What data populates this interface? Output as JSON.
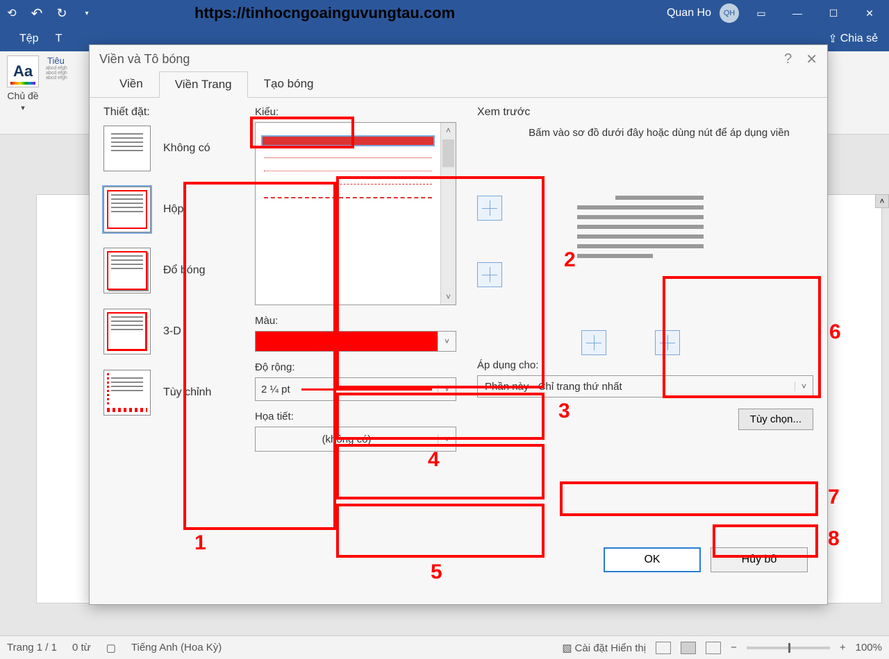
{
  "titlebar": {
    "url": "https://tinhocngoainguvungtau.com",
    "user": "Quan Ho",
    "avatar": "QH"
  },
  "ribbon": {
    "file_tab": "Tệp",
    "themes_label": "Chủ đề",
    "title_style": "Tiêu",
    "share": "Chia sẻ"
  },
  "dialog": {
    "title": "Viền và Tô bóng",
    "tabs": {
      "borders": "Viền",
      "page_border": "Viền Trang",
      "shading": "Tạo bóng"
    },
    "settings_heading": "Thiết đặt:",
    "settings": {
      "none": "Không có",
      "box": "Hộp",
      "shadow": "Đổ bóng",
      "three_d": "3-D",
      "custom": "Tùy chỉnh"
    },
    "style_heading": "Kiểu:",
    "color_heading": "Màu:",
    "width_heading": "Độ rộng:",
    "width_value": "2 ¼ pt",
    "art_heading": "Họa tiết:",
    "art_value": "(không có)",
    "preview_heading": "Xem trước",
    "preview_hint": "Bấm vào sơ đồ dưới đây hoặc dùng nút để áp dụng viền",
    "apply_to_heading": "Áp dụng cho:",
    "apply_to_value": "Phần này - Chỉ trang thứ nhất",
    "options_btn": "Tùy chọn...",
    "ok": "OK",
    "cancel": "Hủy bỏ"
  },
  "statusbar": {
    "page": "Trang 1 / 1",
    "words": "0 từ",
    "lang": "Tiếng Anh (Hoa Kỳ)",
    "display": "Cài đặt Hiển thị",
    "zoom": "100%"
  },
  "annotations": {
    "n1": "1",
    "n2": "2",
    "n3": "3",
    "n4": "4",
    "n5": "5",
    "n6": "6",
    "n7": "7",
    "n8": "8"
  }
}
